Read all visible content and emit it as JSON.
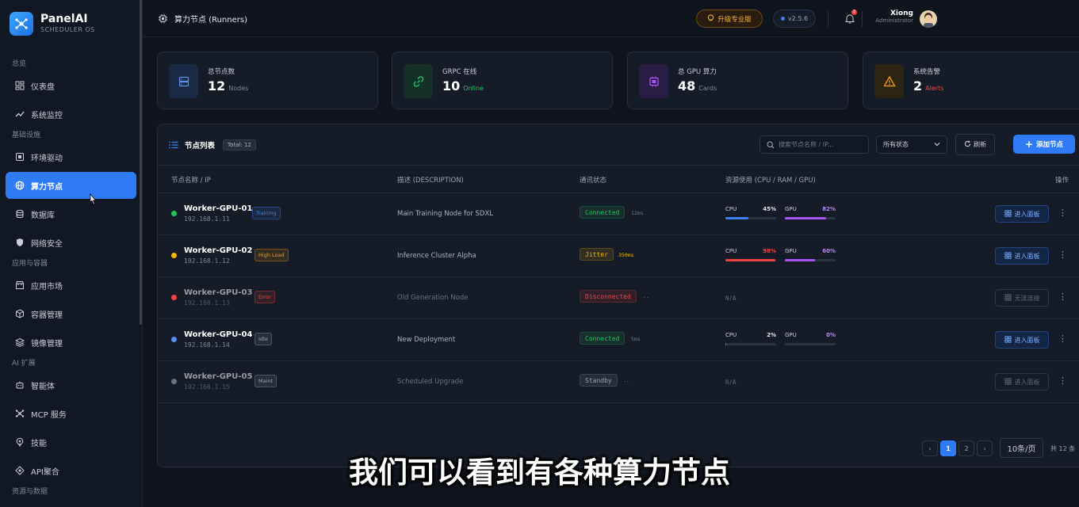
{
  "brand": {
    "name": "PanelAI",
    "subtitle": "SCHEDULER OS"
  },
  "sidebar": {
    "sections": [
      {
        "label": "总览",
        "items": [
          {
            "label": "仪表盘",
            "icon": "dashboard-icon"
          },
          {
            "label": "系统监控",
            "icon": "trend-icon"
          }
        ]
      },
      {
        "label": "基础设施",
        "items": [
          {
            "label": "环境驱动",
            "icon": "driver-icon"
          },
          {
            "label": "算力节点",
            "icon": "globe-icon",
            "active": true
          },
          {
            "label": "数据库",
            "icon": "database-icon"
          },
          {
            "label": "网络安全",
            "icon": "shield-icon"
          }
        ]
      },
      {
        "label": "应用与容器",
        "items": [
          {
            "label": "应用市场",
            "icon": "store-icon"
          },
          {
            "label": "容器管理",
            "icon": "box-icon"
          },
          {
            "label": "镜像管理",
            "icon": "layers-icon"
          }
        ]
      },
      {
        "label": "AI 扩展",
        "items": [
          {
            "label": "智能体",
            "icon": "bot-icon"
          },
          {
            "label": "MCP 服务",
            "icon": "network-icon"
          },
          {
            "label": "技能",
            "icon": "skill-icon"
          },
          {
            "label": "API聚合",
            "icon": "api-icon"
          }
        ]
      },
      {
        "label": "资源与数据",
        "items": []
      }
    ]
  },
  "header": {
    "title": "算力节点 (Runners)",
    "upgrade_label": "升级专业版",
    "version": "v2.5.6",
    "notification_count": "2",
    "user_name": "Xiong",
    "user_role": "Administrator"
  },
  "stats": [
    {
      "label": "总节点数",
      "value": "12",
      "unit": "Nodes",
      "icon": "server-icon",
      "accent": "#5b8def",
      "unit_color": "#7d8797"
    },
    {
      "label": "GRPC 在线",
      "value": "10",
      "unit": "Online",
      "icon": "link-icon",
      "accent": "#22c55e",
      "unit_color": "#22c55e"
    },
    {
      "label": "总 GPU 算力",
      "value": "48",
      "unit": "Cards",
      "icon": "chip-icon",
      "accent": "#a855f7",
      "unit_color": "#7d8797"
    },
    {
      "label": "系统告警",
      "value": "2",
      "unit": "Alerts",
      "icon": "warning-icon",
      "accent": "#f59e0b",
      "unit_color": "#ef4444"
    }
  ],
  "table": {
    "title": "节点列表",
    "total_badge": "Total: 12",
    "search_placeholder": "搜索节点名称 / IP...",
    "filter_value": "所有状态",
    "refresh_label": "刷新",
    "add_label": "添加节点",
    "columns": [
      "节点名称 / IP",
      "描述 (DESCRIPTION)",
      "通讯状态",
      "资源使用 (CPU / RAM / GPU)",
      "操作"
    ],
    "rows": [
      {
        "name": "Worker-GPU-01",
        "ip": "192.168.1.11",
        "tag": "Training",
        "tag_color": "#3b82f6",
        "dot": "#22c55e",
        "desc": "Main Training Node for SDXL",
        "status": "Connected",
        "status_color": "#22c55e",
        "latency": "12ms",
        "latency_color": "#6f7888",
        "cpu": "45%",
        "cpu_value": 45,
        "cpu_color": "#3b82f6",
        "gpu": "82%",
        "gpu_value": 82,
        "gpu_color": "#a855f7",
        "action": "进入面板",
        "dim": false
      },
      {
        "name": "Worker-GPU-02",
        "ip": "192.168.1.12",
        "tag": "High Load",
        "tag_color": "#f59e0b",
        "dot": "#f5b400",
        "desc": "Inference Cluster Alpha",
        "status": "Jitter",
        "status_color": "#f5b400",
        "latency": "350ms",
        "latency_color": "#f5b400",
        "cpu": "98%",
        "cpu_value": 98,
        "cpu_color": "#ef4444",
        "gpu": "60%",
        "gpu_value": 60,
        "gpu_color": "#a855f7",
        "action": "进入面板",
        "dim": false
      },
      {
        "name": "Worker-GPU-03",
        "ip": "192.168.1.13",
        "tag": "Error",
        "tag_color": "#ef4444",
        "dot": "#ef4444",
        "desc": "Old Generation Node",
        "status": "Disconnected",
        "status_color": "#ef4444",
        "latency": "--",
        "latency_color": "#6f7888",
        "na": "N/A",
        "action": "无法连接",
        "dim": true
      },
      {
        "name": "Worker-GPU-04",
        "ip": "192.168.1.14",
        "tag": "Idle",
        "tag_color": "#9aa3b2",
        "dot": "#5b8def",
        "desc": "New Deployment",
        "status": "Connected",
        "status_color": "#22c55e",
        "latency": "5ms",
        "latency_color": "#6f7888",
        "cpu": "2%",
        "cpu_value": 2,
        "cpu_color": "#3b82f6",
        "gpu": "0%",
        "gpu_value": 0,
        "gpu_color": "#a855f7",
        "action": "进入面板",
        "dim": false
      },
      {
        "name": "Worker-GPU-05",
        "ip": "192.168.1.15",
        "tag": "Maint",
        "tag_color": "#9aa3b2",
        "dot": "#6b7280",
        "desc": "Scheduled Upgrade",
        "status": "Standby",
        "status_color": "#9aa3b2",
        "latency": "--",
        "latency_color": "#6f7888",
        "na": "N/A",
        "action": "进入面板",
        "dim": true
      }
    ],
    "resource_labels": {
      "cpu": "CPU",
      "gpu": "GPU"
    }
  },
  "pagination": {
    "prev": "‹",
    "pages": [
      "1",
      "2"
    ],
    "current": "1",
    "next": "›",
    "page_size": "10条/页",
    "total": "共 12 条"
  },
  "subtitle": "我们可以看到有各种算力节点"
}
